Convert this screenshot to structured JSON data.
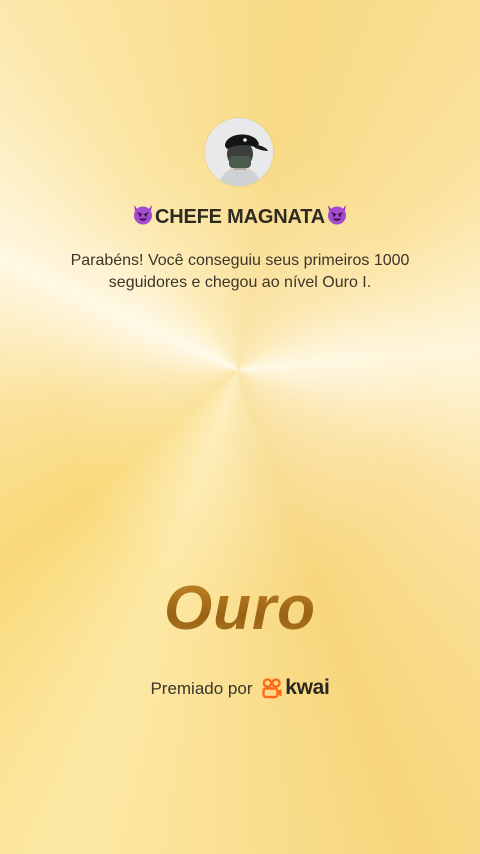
{
  "profile": {
    "avatar_icon": "avatar-person-with-cap-icon",
    "username": "CHEFE MAGNATA",
    "username_prefix_icon": "smiling-devil-emoji-icon",
    "username_suffix_icon": "smiling-devil-emoji-icon"
  },
  "message": {
    "line1": "Parabéns! Você conseguiu seus primeiros 1000",
    "line2": "seguidores e chegou ao nível Ouro I."
  },
  "badge": {
    "title": "Ouro",
    "color": "#a9701c"
  },
  "footer": {
    "awarded_by": "Premiado por",
    "brand_icon": "kwai-logo-icon",
    "brand_name": "kwai",
    "brand_color": "#ff6a1a"
  },
  "colors": {
    "background": "#fbe29a",
    "text": "#3b352a"
  }
}
